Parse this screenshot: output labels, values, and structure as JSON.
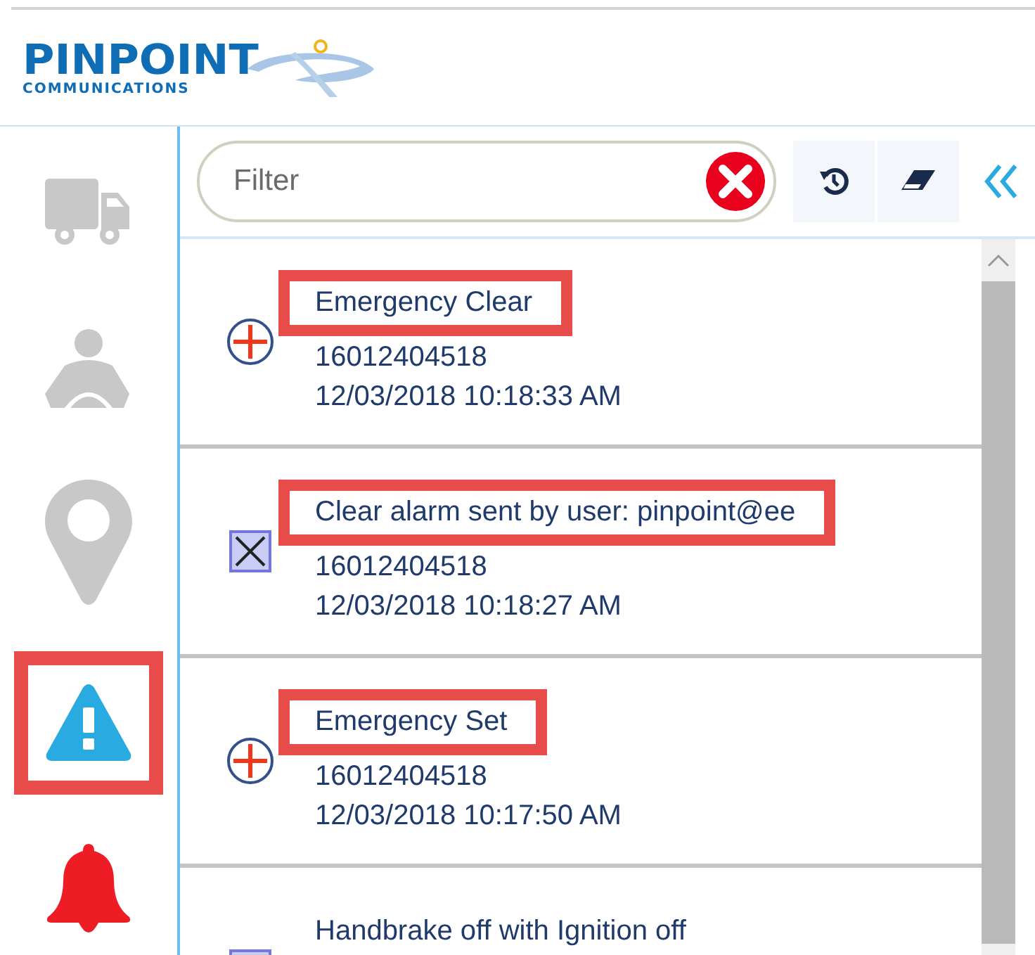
{
  "logo": {
    "name": "PINPOINT",
    "tagline": "COMMUNICATIONS"
  },
  "sidebar": {
    "items": [
      {
        "kind": "truck",
        "selected": false
      },
      {
        "kind": "driver",
        "selected": false
      },
      {
        "kind": "pin",
        "selected": false
      },
      {
        "kind": "warning",
        "selected": true
      },
      {
        "kind": "bell",
        "selected": false
      }
    ]
  },
  "filter": {
    "placeholder": "Filter"
  },
  "events": [
    {
      "kind": "emergency",
      "title": "Emergency Clear",
      "highlighted": true,
      "id": "16012404518",
      "time": "12/03/2018 10:18:33 AM"
    },
    {
      "kind": "cleared",
      "title": "Clear alarm sent by user: pinpoint@ee",
      "highlighted": true,
      "id": "16012404518",
      "time": "12/03/2018 10:18:27 AM"
    },
    {
      "kind": "emergency",
      "title": "Emergency Set",
      "highlighted": true,
      "id": "16012404518",
      "time": "12/03/2018 10:17:50 AM"
    },
    {
      "kind": "cleared",
      "title": "Handbrake off with Ignition off",
      "highlighted": false
    }
  ]
}
